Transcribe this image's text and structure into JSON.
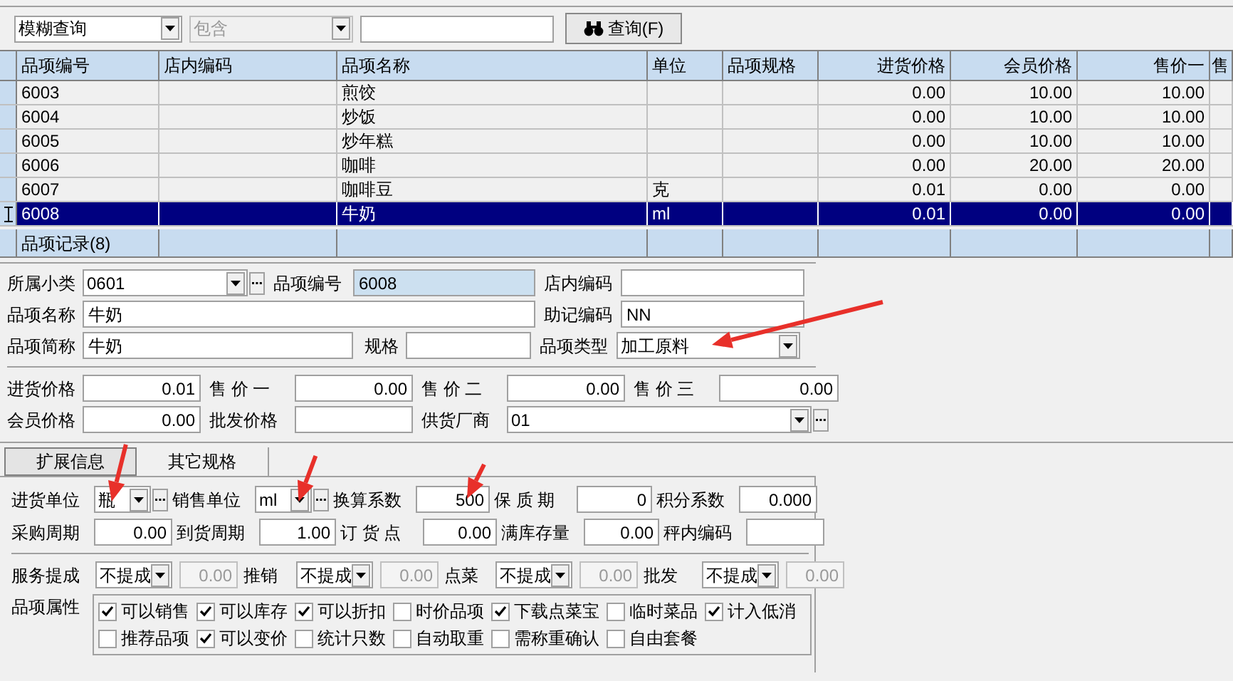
{
  "query": {
    "mode": "模糊查询",
    "condition": "包含",
    "condition_disabled": true,
    "button": "查询(F)"
  },
  "grid": {
    "columns": [
      "品项编号",
      "店内编码",
      "品项名称",
      "单位",
      "品项规格",
      "进货价格",
      "会员价格",
      "售价一",
      "售"
    ],
    "rows": [
      {
        "cells": [
          "6003",
          "",
          "煎饺",
          "",
          "",
          "0.00",
          "10.00",
          "10.00",
          ""
        ],
        "selected": false
      },
      {
        "cells": [
          "6004",
          "",
          "炒饭",
          "",
          "",
          "0.00",
          "10.00",
          "10.00",
          ""
        ],
        "selected": false
      },
      {
        "cells": [
          "6005",
          "",
          "炒年糕",
          "",
          "",
          "0.00",
          "10.00",
          "10.00",
          ""
        ],
        "selected": false
      },
      {
        "cells": [
          "6006",
          "",
          "咖啡",
          "",
          "",
          "0.00",
          "20.00",
          "20.00",
          ""
        ],
        "selected": false
      },
      {
        "cells": [
          "6007",
          "",
          "咖啡豆",
          "克",
          "",
          "0.01",
          "0.00",
          "0.00",
          ""
        ],
        "selected": false
      },
      {
        "cells": [
          "6008",
          "",
          "牛奶",
          "ml",
          "",
          "0.01",
          "0.00",
          "0.00",
          ""
        ],
        "selected": true
      }
    ],
    "footer": "品项记录(8)"
  },
  "form": [
    [
      {
        "label": "所属小类",
        "value": "0601",
        "kind": "combo"
      },
      {
        "label": "品项编号",
        "value": "6008",
        "kind": "readonly"
      },
      {
        "label": "店内编码",
        "kind": "text"
      }
    ],
    [
      {
        "label": "品项名称",
        "value": "牛奶",
        "kind": "text"
      },
      {
        "label": "助记编码",
        "value": "NN",
        "kind": "text"
      }
    ],
    [
      {
        "label": "品项简称",
        "value": "牛奶",
        "kind": "text"
      },
      {
        "label": "规格",
        "kind": "text"
      },
      {
        "label": "品项类型",
        "value": "加工原料",
        "kind": "select"
      }
    ],
    [
      {
        "label": "进货价格",
        "value": "0.01",
        "kind": "number"
      },
      {
        "label": "售 价 一",
        "value": "0.00",
        "kind": "number"
      },
      {
        "label": "售 价 二",
        "value": "0.00",
        "kind": "number"
      },
      {
        "label": "售 价 三",
        "value": "0.00",
        "kind": "number"
      }
    ],
    [
      {
        "label": "会员价格",
        "value": "0.00",
        "kind": "number"
      },
      {
        "label": "批发价格",
        "kind": "number"
      },
      {
        "label": "供货厂商",
        "value": "01",
        "kind": "combo"
      }
    ]
  ],
  "tabs": [
    {
      "label": "扩展信息",
      "selected": true
    },
    {
      "label": "其它规格",
      "selected": false
    }
  ],
  "extended": [
    [
      {
        "label": "进货单位",
        "value": "瓶",
        "kind": "combo"
      },
      {
        "label": "销售单位",
        "value": "ml",
        "kind": "combo"
      },
      {
        "label": "换算系数",
        "value": "500",
        "kind": "number"
      },
      {
        "label": "保 质 期",
        "value": "0",
        "kind": "number"
      },
      {
        "label": "积分系数",
        "value": "0.000",
        "kind": "number"
      }
    ],
    [
      {
        "label": "采购周期",
        "value": "0.00",
        "kind": "number"
      },
      {
        "label": "到货周期",
        "value": "1.00",
        "kind": "number"
      },
      {
        "label": "订 货 点",
        "value": "0.00",
        "kind": "number"
      },
      {
        "label": "满库存量",
        "value": "0.00",
        "kind": "number"
      },
      {
        "label": "秤内编码",
        "kind": "text"
      }
    ]
  ],
  "commissions": [
    {
      "label": "服务提成",
      "mode": "不提成",
      "amount": "0.00",
      "amount_disabled": true
    },
    {
      "label": "推销",
      "mode": "不提成",
      "amount": "0.00",
      "amount_disabled": true
    },
    {
      "label": "点菜",
      "mode": "不提成",
      "amount": "0.00",
      "amount_disabled": true
    },
    {
      "label": "批发",
      "mode": "不提成",
      "amount": "0.00",
      "amount_disabled": true
    }
  ],
  "attributes": {
    "label": "品项属性",
    "rows": [
      [
        {
          "label": "可以销售",
          "checked": true
        },
        {
          "label": "可以库存",
          "checked": true
        },
        {
          "label": "可以折扣",
          "checked": true
        },
        {
          "label": "时价品项",
          "checked": false
        },
        {
          "label": "下载点菜宝",
          "checked": true
        },
        {
          "label": "临时菜品",
          "checked": false
        },
        {
          "label": "计入低消",
          "checked": true
        }
      ],
      [
        {
          "label": "推荐品项",
          "checked": false
        },
        {
          "label": "可以变价",
          "checked": true
        },
        {
          "label": "统计只数",
          "checked": false
        },
        {
          "label": "自动取重",
          "checked": false
        },
        {
          "label": "需称重确认",
          "checked": false
        },
        {
          "label": "自由套餐",
          "checked": false
        }
      ]
    ]
  }
}
